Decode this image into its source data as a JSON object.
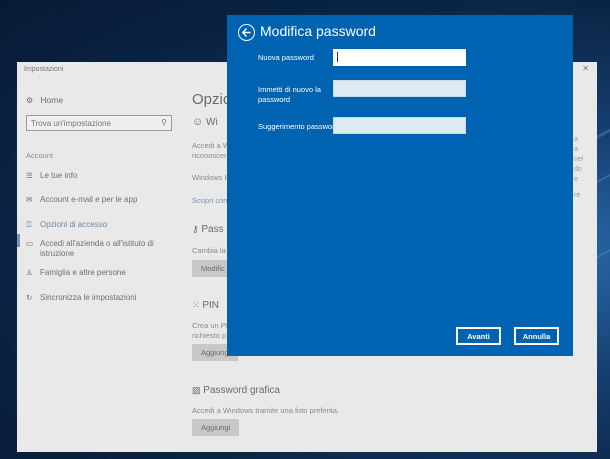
{
  "settings_window": {
    "title": "Impostazioni",
    "close_glyph": "✕",
    "sidebar": {
      "home": "Home",
      "search_placeholder": "Trova un'impostazione",
      "section": "Account",
      "items": [
        {
          "label": "Le tue info",
          "icon": "person-card-icon"
        },
        {
          "label": "Account e-mail e per le app",
          "icon": "mail-icon"
        },
        {
          "label": "Opzioni di accesso",
          "icon": "key-icon"
        },
        {
          "label": "Accedi all'azienda o all'istituto di istruzione",
          "icon": "briefcase-icon"
        },
        {
          "label": "Famiglia e altre persone",
          "icon": "people-icon"
        },
        {
          "label": "Sincronizza le impostazioni",
          "icon": "sync-icon"
        }
      ]
    },
    "main": {
      "title": "Opzio",
      "hello": {
        "heading": "Wi",
        "line1": "Accedi a W",
        "line2": "riconoscer",
        "line3": "Windows H",
        "link": "Scopri com"
      },
      "password": {
        "heading": "Pass",
        "line1": "Cambia la",
        "button": "Modific"
      },
      "pin": {
        "heading": "PIN",
        "line1": "Crea un PI",
        "line2": "richiesto p",
        "button": "Aggiung"
      },
      "picture_password": {
        "heading": "Password grafica",
        "line1": "Accedi a Windows tramite una foto preferita.",
        "button": "Aggiungi"
      },
      "right_fragments": [
        "a",
        "a",
        "nel",
        "do",
        "e",
        "re"
      ]
    }
  },
  "dialog": {
    "title": "Modifica password",
    "fields": [
      {
        "label": "Nuova password",
        "value": ""
      },
      {
        "label": "Immetti di nuovo la password",
        "value": ""
      },
      {
        "label": "Suggerimento password",
        "value": ""
      }
    ],
    "next_button": "Avanti",
    "cancel_button": "Annulla"
  },
  "colors": {
    "dialog_bg": "#0063b1",
    "settings_bg": "#e9e9e9"
  }
}
